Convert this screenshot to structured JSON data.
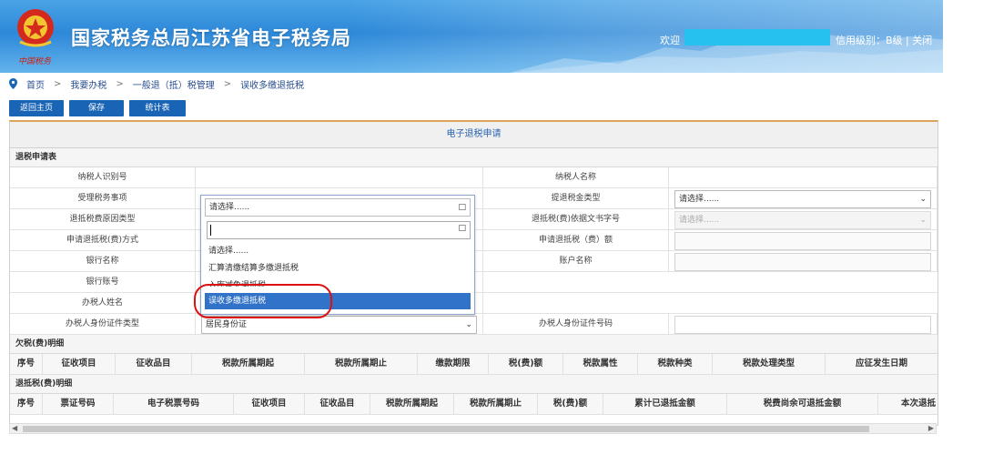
{
  "header": {
    "site_title": "国家税务总局江苏省电子税务局",
    "welcome": "欢迎",
    "credit_info": "信用级别：B级 | 关闭",
    "logo_signature": "中国税务"
  },
  "breadcrumb": [
    "首页",
    "我要办税",
    "一般退（抵）税管理",
    "误收多缴退抵税"
  ],
  "breadcrumb_sep": ">",
  "toolbar": {
    "home": "返回主页",
    "save": "保存",
    "stats": "统计表"
  },
  "panel_title": "电子退税申请",
  "section_apply": "退税申请表",
  "form": {
    "taxpayer_id": "纳税人识别号",
    "taxpayer_name": "纳税人名称",
    "matter": "受理税务事项",
    "matter_value": "请选择......",
    "refund_type": "提退税金类型",
    "refund_type_value": "请选择......",
    "reason_type": "退抵税费原因类型",
    "doc_no": "退抵税(费)依据文书字号",
    "doc_no_value": "请选择......",
    "method": "申请退抵税(费)方式",
    "amount": "申请退抵税（费）额",
    "bank_name": "银行名称",
    "account_name": "账户名称",
    "bank_account": "银行账号",
    "handler_name": "办税人姓名",
    "id_type": "办税人身份证件类型",
    "id_type_value": "居民身份证",
    "id_number": "办税人身份证件号码"
  },
  "dropdown": {
    "current": "请选择......",
    "options": [
      "请选择......",
      "汇算清缴结算多缴退抵税",
      "入库减免退抵税",
      "误收多缴退抵税"
    ],
    "highlighted": "误收多缴退抵税"
  },
  "section_owed": "欠税(费)明细",
  "owed_columns": [
    "序号",
    "征收项目",
    "征收品目",
    "税款所属期起",
    "税款所属期止",
    "缴款期限",
    "税(费)额",
    "税款属性",
    "税款种类",
    "税款处理类型",
    "应征发生日期"
  ],
  "section_refund": "退抵税(费)明细",
  "refund_columns": [
    "序号",
    "票证号码",
    "电子税票号码",
    "征收项目",
    "征收品目",
    "税款所属期起",
    "税款所属期止",
    "税(费)额",
    "累计已退抵金额",
    "税费尚余可退抵金额",
    "本次退抵"
  ],
  "colors": {
    "banner": "#2d88d8",
    "button": "#1a64b6",
    "highlight": "#3173c8",
    "annotation": "#dd1111"
  }
}
